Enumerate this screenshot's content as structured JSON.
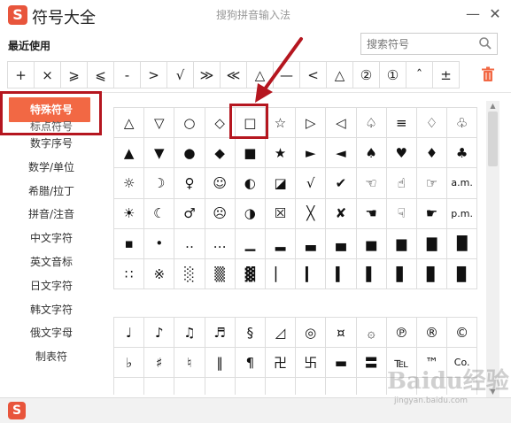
{
  "window": {
    "title": "符号大全",
    "ime_name": "搜狗拼音输入法",
    "logo": "S",
    "minimize": "—",
    "close": "✕"
  },
  "recent": {
    "label": "最近使用",
    "symbols": [
      "+",
      "×",
      "⩾",
      "⩽",
      "-",
      ">",
      "√",
      "≫",
      "≪",
      "△",
      "—",
      "<",
      "△",
      "②",
      "①",
      "ˆ",
      "±"
    ]
  },
  "search": {
    "placeholder": "搜索符号"
  },
  "sidebar": {
    "items": [
      {
        "label": "特殊符号",
        "active": true
      },
      {
        "label": "标点符号",
        "active": false
      },
      {
        "label": "数字序号",
        "active": false
      },
      {
        "label": "数学/单位",
        "active": false
      },
      {
        "label": "希腊/拉丁",
        "active": false
      },
      {
        "label": "拼音/注音",
        "active": false
      },
      {
        "label": "中文字符",
        "active": false
      },
      {
        "label": "英文音标",
        "active": false
      },
      {
        "label": "日文字符",
        "active": false
      },
      {
        "label": "韩文字符",
        "active": false
      },
      {
        "label": "俄文字母",
        "active": false
      },
      {
        "label": "制表符",
        "active": false
      }
    ]
  },
  "grid1": [
    [
      "△",
      "▽",
      "○",
      "◇",
      "□",
      "☆",
      "▷",
      "◁",
      "♤",
      "≡",
      "♢",
      "♧"
    ],
    [
      "▲",
      "▼",
      "●",
      "◆",
      "■",
      "★",
      "►",
      "◄",
      "♠",
      "♥",
      "♦",
      "♣"
    ],
    [
      "☼",
      "☽",
      "♀",
      "☺",
      "◐",
      "◪",
      "√",
      "✔",
      "☜",
      "☝",
      "☞",
      "a.m."
    ],
    [
      "☀",
      "☾",
      "♂",
      "☹",
      "◑",
      "☒",
      "╳",
      "✘",
      "☚",
      "☟",
      "☛",
      "p.m."
    ],
    [
      "▪",
      "•",
      "‥",
      "…",
      "▁",
      "▂",
      "▃",
      "▄",
      "▅",
      "▆",
      "▇",
      "█"
    ],
    [
      "∷",
      "※",
      "░",
      "▒",
      "▓",
      "▏",
      "▎",
      "▍",
      "▌",
      "▋",
      "▊",
      "▉"
    ]
  ],
  "grid2": [
    [
      "♩",
      "♪",
      "♫",
      "♬",
      "§",
      "◿",
      "◎",
      "¤",
      "۞",
      "℗",
      "®",
      "©"
    ],
    [
      "♭",
      "♯",
      "♮",
      "‖",
      "¶",
      "卍",
      "卐",
      "▬",
      "〓",
      "℡",
      "™",
      "Co."
    ],
    [
      "",
      "",
      "",
      "",
      "",
      "",
      "",
      "",
      "",
      "",
      "",
      ""
    ]
  ],
  "watermark": {
    "text": "Baidu经验",
    "sub": "jingyan.baidu.com"
  },
  "colors": {
    "accent": "#f26844",
    "highlight": "#b5161f",
    "logo": "#e8553c"
  }
}
